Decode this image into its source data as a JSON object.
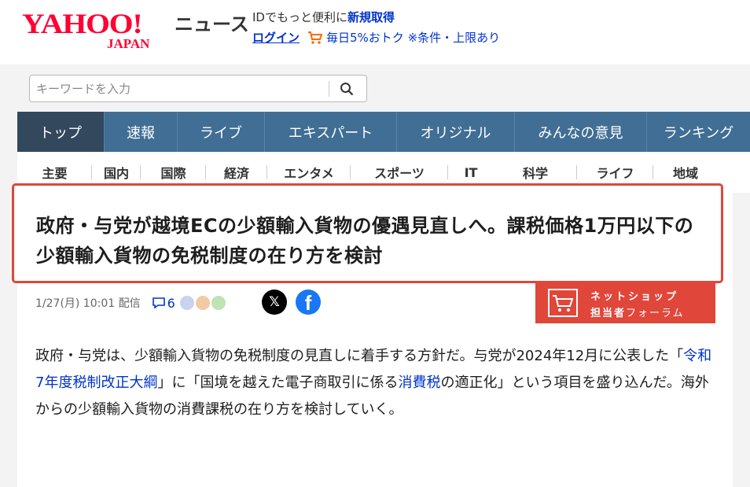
{
  "header": {
    "logo_yahoo": "YAHOO!",
    "logo_japan": "JAPAN",
    "section": "ニュース",
    "id_text": "IDでもっと便利に",
    "id_link": "新規取得",
    "login": "ログイン",
    "promo": "毎日5%おトク ※条件・上限あり"
  },
  "search": {
    "placeholder": "キーワードを入力"
  },
  "main_nav": [
    "トップ",
    "速報",
    "ライブ",
    "エキスパート",
    "オリジナル",
    "みんなの意見",
    "ランキング"
  ],
  "sub_nav": [
    "主要",
    "国内",
    "国際",
    "経済",
    "エンタメ",
    "スポーツ",
    "IT",
    "科学",
    "ライフ",
    "地域"
  ],
  "article": {
    "title": "政府・与党が越境ECの少額輸入貨物の優遇見直しへ。課税価格1万円以下の少額輸入貨物の免税制度の在り方を検討",
    "date": "1/27(月) 10:01 配信",
    "comment_count": "6",
    "ad_line1": "ネットショップ",
    "ad_line2_bold": "担当者",
    "ad_line2": "フォーラム",
    "body": {
      "p1": "政府・与党は、少額輸入貨物の免税制度の見直しに着手する方針だ。与党が2024年12月に公表した「",
      "link1": "令和7年度税制改正大綱",
      "p2": "」に「国境を越えた電子商取引に係る",
      "link2": "消費税",
      "p3": "の適正化」という項目を盛り込んだ。海外からの少額輸入貨物の消費課税の在り方を検討していく。"
    }
  },
  "colors": {
    "brand": "#ff0033",
    "nav": "#406e94",
    "nav_active": "#33485c",
    "highlight": "#e0463a",
    "link": "#0033cc"
  }
}
